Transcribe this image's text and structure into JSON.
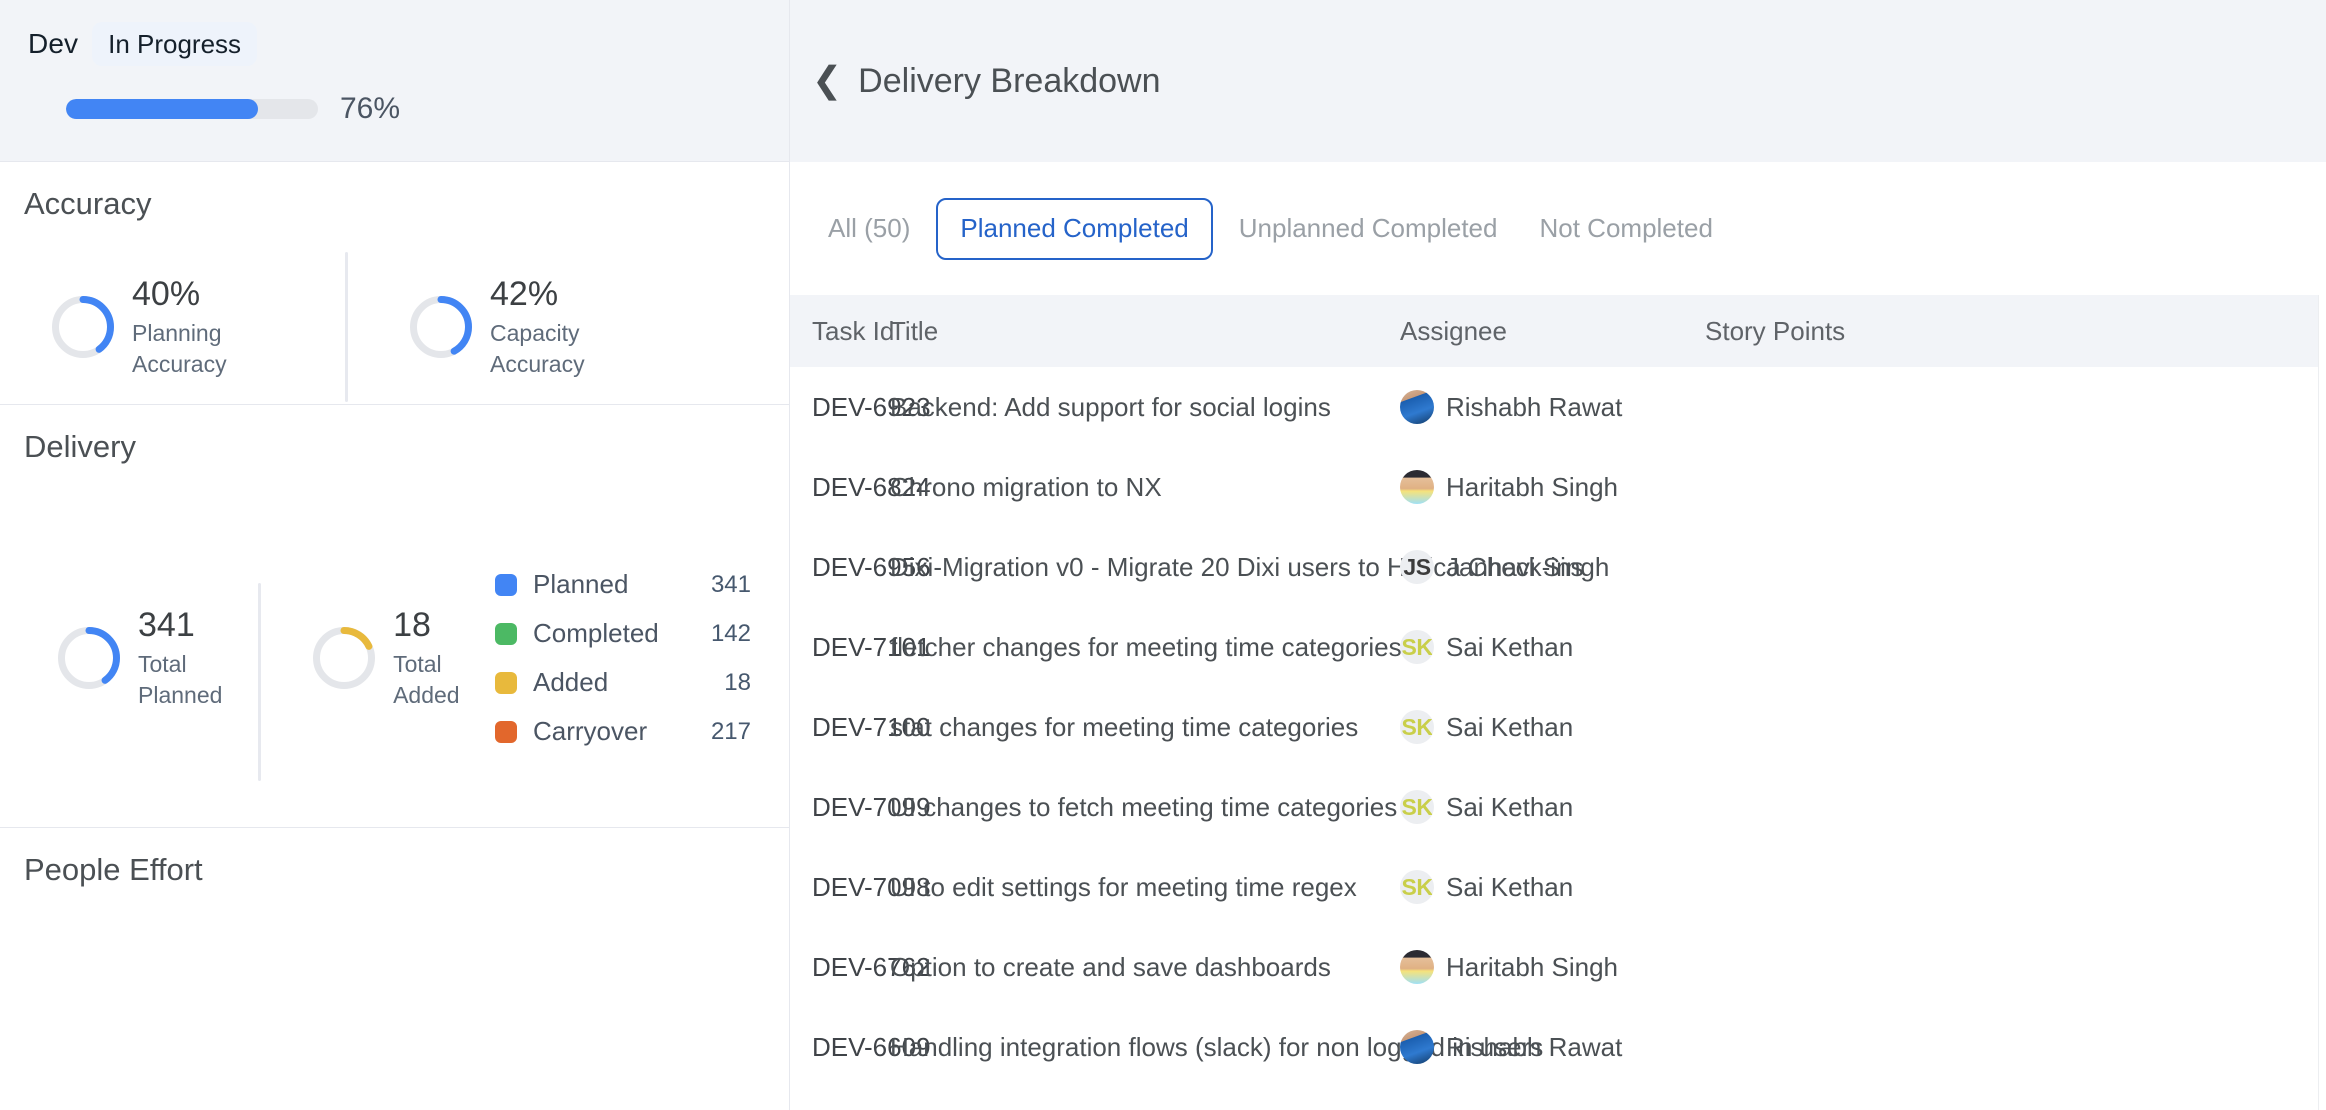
{
  "sprint": {
    "name": "Dev",
    "status": "In Progress",
    "progress_percent": 76,
    "progress_label": "76%"
  },
  "accuracy": {
    "title": "Accuracy",
    "metrics": [
      {
        "value": "40%",
        "percent": 40,
        "label": "Planning\nAccuracy",
        "color": "#4285f4"
      },
      {
        "value": "42%",
        "percent": 42,
        "label": "Capacity\nAccuracy",
        "color": "#4285f4"
      }
    ]
  },
  "delivery": {
    "title": "Delivery",
    "metrics": [
      {
        "value": "341",
        "percent": 40,
        "label": "Total\nPlanned",
        "color": "#4285f4"
      },
      {
        "value": "18",
        "percent": 18,
        "label": "Total\nAdded",
        "color": "#e8b93c"
      }
    ],
    "legend": [
      {
        "label": "Planned",
        "value": "341",
        "color": "#4285f4"
      },
      {
        "label": "Completed",
        "value": "142",
        "color": "#4cb964"
      },
      {
        "label": "Added",
        "value": "18",
        "color": "#e8b93c"
      },
      {
        "label": "Carryover",
        "value": "217",
        "color": "#e2672c"
      }
    ]
  },
  "people_effort": {
    "title": "People Effort"
  },
  "detail": {
    "back_icon": "chevron-left-icon",
    "title": "Delivery Breakdown",
    "tabs": [
      {
        "label": "All (50)",
        "active": false
      },
      {
        "label": "Planned Completed",
        "active": true
      },
      {
        "label": "Unplanned Completed",
        "active": false
      },
      {
        "label": "Not Completed",
        "active": false
      }
    ],
    "table": {
      "columns": [
        "Task Id",
        "Title",
        "Assignee",
        "Story Points"
      ],
      "rows": [
        {
          "task_id": "DEV-6923",
          "title": "Backend: Add support for social logins",
          "assignee": "Rishabh Rawat",
          "avatar_type": "photo-a",
          "initials": "",
          "initials_color": "",
          "story_points": ""
        },
        {
          "task_id": "DEV-6824",
          "title": "Chrono migration to NX",
          "assignee": "Haritabh Singh",
          "avatar_type": "photo-b",
          "initials": "",
          "initials_color": "",
          "story_points": ""
        },
        {
          "task_id": "DEV-6956",
          "title": "Dixi-Migration v0 - Migrate 20 Dixi users to Hatica Check-ins",
          "assignee": "Janhavi Singh",
          "avatar_type": "initials",
          "initials": "JS",
          "initials_color": "#3c3c3c",
          "story_points": ""
        },
        {
          "task_id": "DEV-7101",
          "title": "fletcher changes for meeting time categories",
          "assignee": "Sai Kethan",
          "avatar_type": "initials",
          "initials": "SK",
          "initials_color": "#c9cf4a",
          "story_points": ""
        },
        {
          "task_id": "DEV-7100",
          "title": "stat changes for meeting time categories",
          "assignee": "Sai Kethan",
          "avatar_type": "initials",
          "initials": "SK",
          "initials_color": "#c9cf4a",
          "story_points": ""
        },
        {
          "task_id": "DEV-7099",
          "title": "UI changes to fetch meeting time categories",
          "assignee": "Sai Kethan",
          "avatar_type": "initials",
          "initials": "SK",
          "initials_color": "#c9cf4a",
          "story_points": ""
        },
        {
          "task_id": "DEV-7098",
          "title": "UI to edit settings for meeting time regex",
          "assignee": "Sai Kethan",
          "avatar_type": "initials",
          "initials": "SK",
          "initials_color": "#c9cf4a",
          "story_points": ""
        },
        {
          "task_id": "DEV-6762",
          "title": "Option to create and save dashboards",
          "assignee": "Haritabh Singh",
          "avatar_type": "photo-b",
          "initials": "",
          "initials_color": "",
          "story_points": ""
        },
        {
          "task_id": "DEV-6609",
          "title": "Handling integration flows (slack) for non logged in users",
          "assignee": "Rishabh Rawat",
          "avatar_type": "photo-a",
          "initials": "",
          "initials_color": "",
          "story_points": ""
        }
      ]
    }
  },
  "colors": {
    "accent_blue": "#4285f4",
    "tab_blue": "#2563c9",
    "track_gray": "#e4e6ea",
    "header_bg": "#f2f4f8"
  }
}
